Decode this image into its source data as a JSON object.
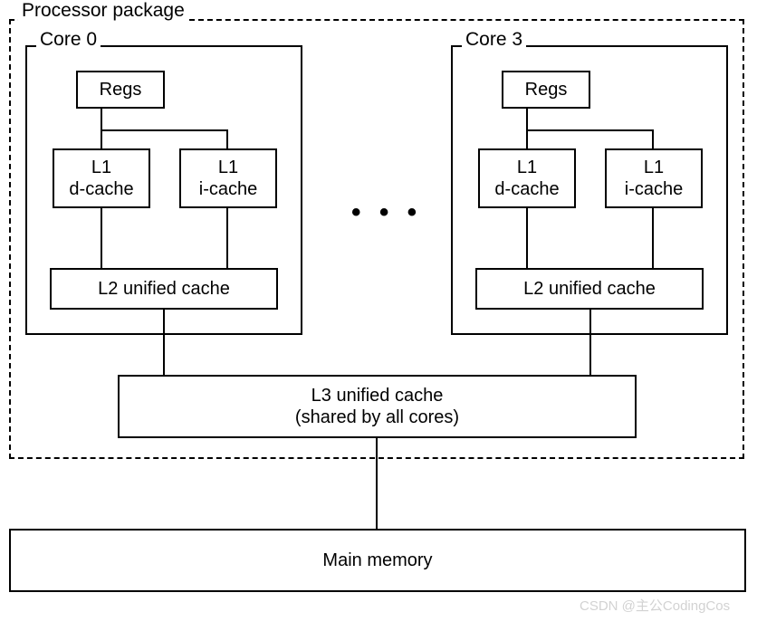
{
  "diagram": {
    "package_label": "Processor package",
    "core_left_label": "Core 0",
    "core_right_label": "Core 3",
    "regs": "Regs",
    "l1_dcache_line1": "L1",
    "l1_dcache_line2": "d-cache",
    "l1_icache_line1": "L1",
    "l1_icache_line2": "i-cache",
    "l2_cache": "L2 unified cache",
    "l3_line1": "L3 unified cache",
    "l3_line2": "(shared by all cores)",
    "main_memory": "Main memory",
    "ellipsis": "• • •",
    "watermark": "CSDN @主公CodingCos"
  }
}
